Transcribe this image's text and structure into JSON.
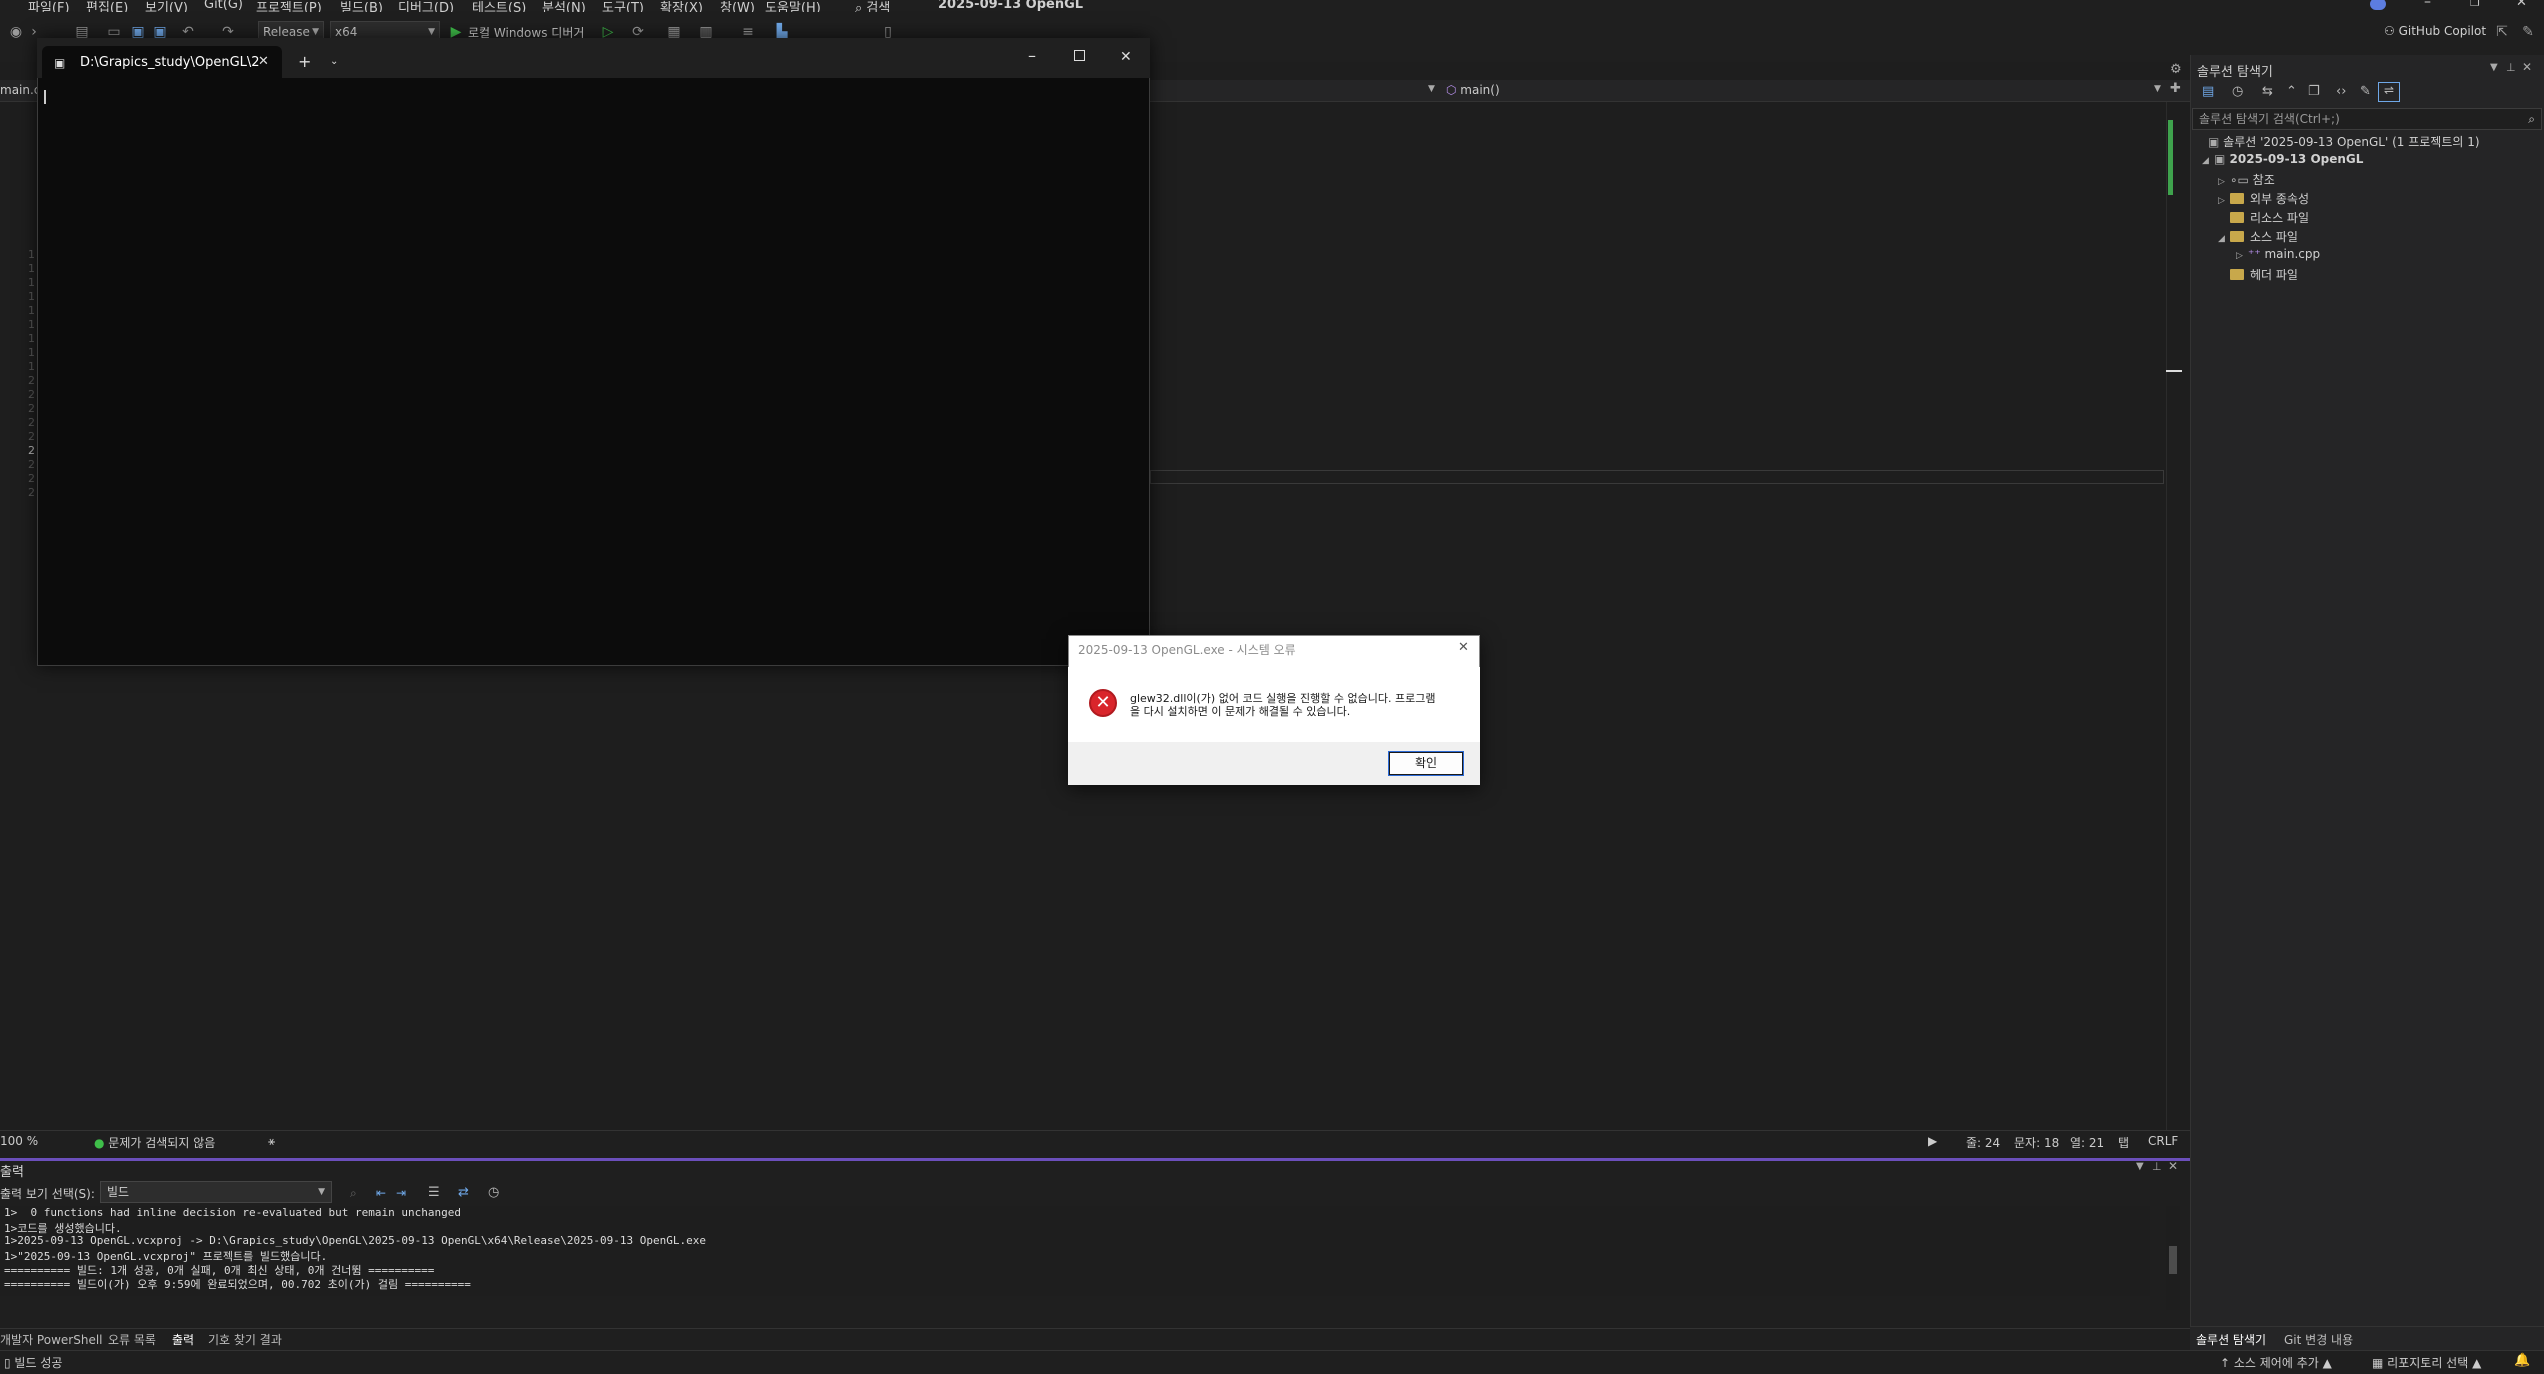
{
  "menus": [
    "파일(F)",
    "편집(E)",
    "보기(V)",
    "Git(G)",
    "프로젝트(P)",
    "빌드(B)",
    "디버그(D)",
    "테스트(S)",
    "분석(N)",
    "도구(T)",
    "확장(X)",
    "창(W)",
    "도움말(H)"
  ],
  "search_label": "검색",
  "window_title": "2025-09-13 OpenGL",
  "toolbar": {
    "config": "Release",
    "platform": "x64",
    "debugger": "로컬 Windows 디버거",
    "copilot": "GitHub Copilot"
  },
  "editor": {
    "file_tab": "main.cpp",
    "func_nav": "main()",
    "line_numbers": [
      "1",
      "1",
      "1",
      "1",
      "1",
      "1",
      "1",
      "1",
      "1",
      "2",
      "2",
      "2",
      "2",
      "2",
      "2",
      "2",
      "2",
      "2"
    ]
  },
  "editor_status": {
    "zoom": "100 %",
    "issues": "문제가 검색되지 않음",
    "line": "줄: 24",
    "char": "문자: 18",
    "col": "열: 21",
    "tab": "탭",
    "eol": "CRLF"
  },
  "output": {
    "title": "출력",
    "select_label": "출력 보기 선택(S):",
    "select_value": "빌드",
    "lines": [
      "1>  0 functions had inline decision re-evaluated but remain unchanged",
      "1>코드를 생성했습니다.",
      "1>2025-09-13 OpenGL.vcxproj -> D:\\Grapics_study\\OpenGL\\2025-09-13 OpenGL\\x64\\Release\\2025-09-13 OpenGL.exe",
      "1>\"2025-09-13 OpenGL.vcxproj\" 프로젝트를 빌드했습니다.",
      "========== 빌드: 1개 성공, 0개 실패, 0개 최신 상태, 0개 건너뜀 ==========",
      "========== 빌드이(가) 오후 9:59에 완료되었으며, 00.702 초이(가) 걸림 =========="
    ],
    "tabs": [
      "개발자 PowerShell",
      "오류 목록",
      "출력",
      "기호 찾기 결과"
    ]
  },
  "solution_explorer": {
    "title": "솔루션 탐색기",
    "search_placeholder": "솔루션 탐색기 검색(Ctrl+;)",
    "solution": "솔루션 '2025-09-13 OpenGL' (1 프로젝트의 1)",
    "project": "2025-09-13 OpenGL",
    "items": [
      "참조",
      "외부 종속성",
      "리소스 파일",
      "소스 파일",
      "main.cpp",
      "헤더 파일"
    ],
    "bottom_tabs": [
      "솔루션 탐색기",
      "Git 변경 내용"
    ]
  },
  "statusbar": {
    "build": "빌드 성공",
    "source_control": "소스 제어에 추가",
    "repo": "리포지토리 선택"
  },
  "terminal": {
    "tab_title": "D:\\Grapics_study\\OpenGL\\2"
  },
  "dialog": {
    "title": "2025-09-13 OpenGL.exe - 시스템 오류",
    "message_line1": "glew32.dll이(가) 없어 코드 실행을 진행할 수 없습니다. 프로그램",
    "message_line2": "을 다시 설치하면 이 문제가 해결될 수 있습니다.",
    "ok": "확인"
  }
}
